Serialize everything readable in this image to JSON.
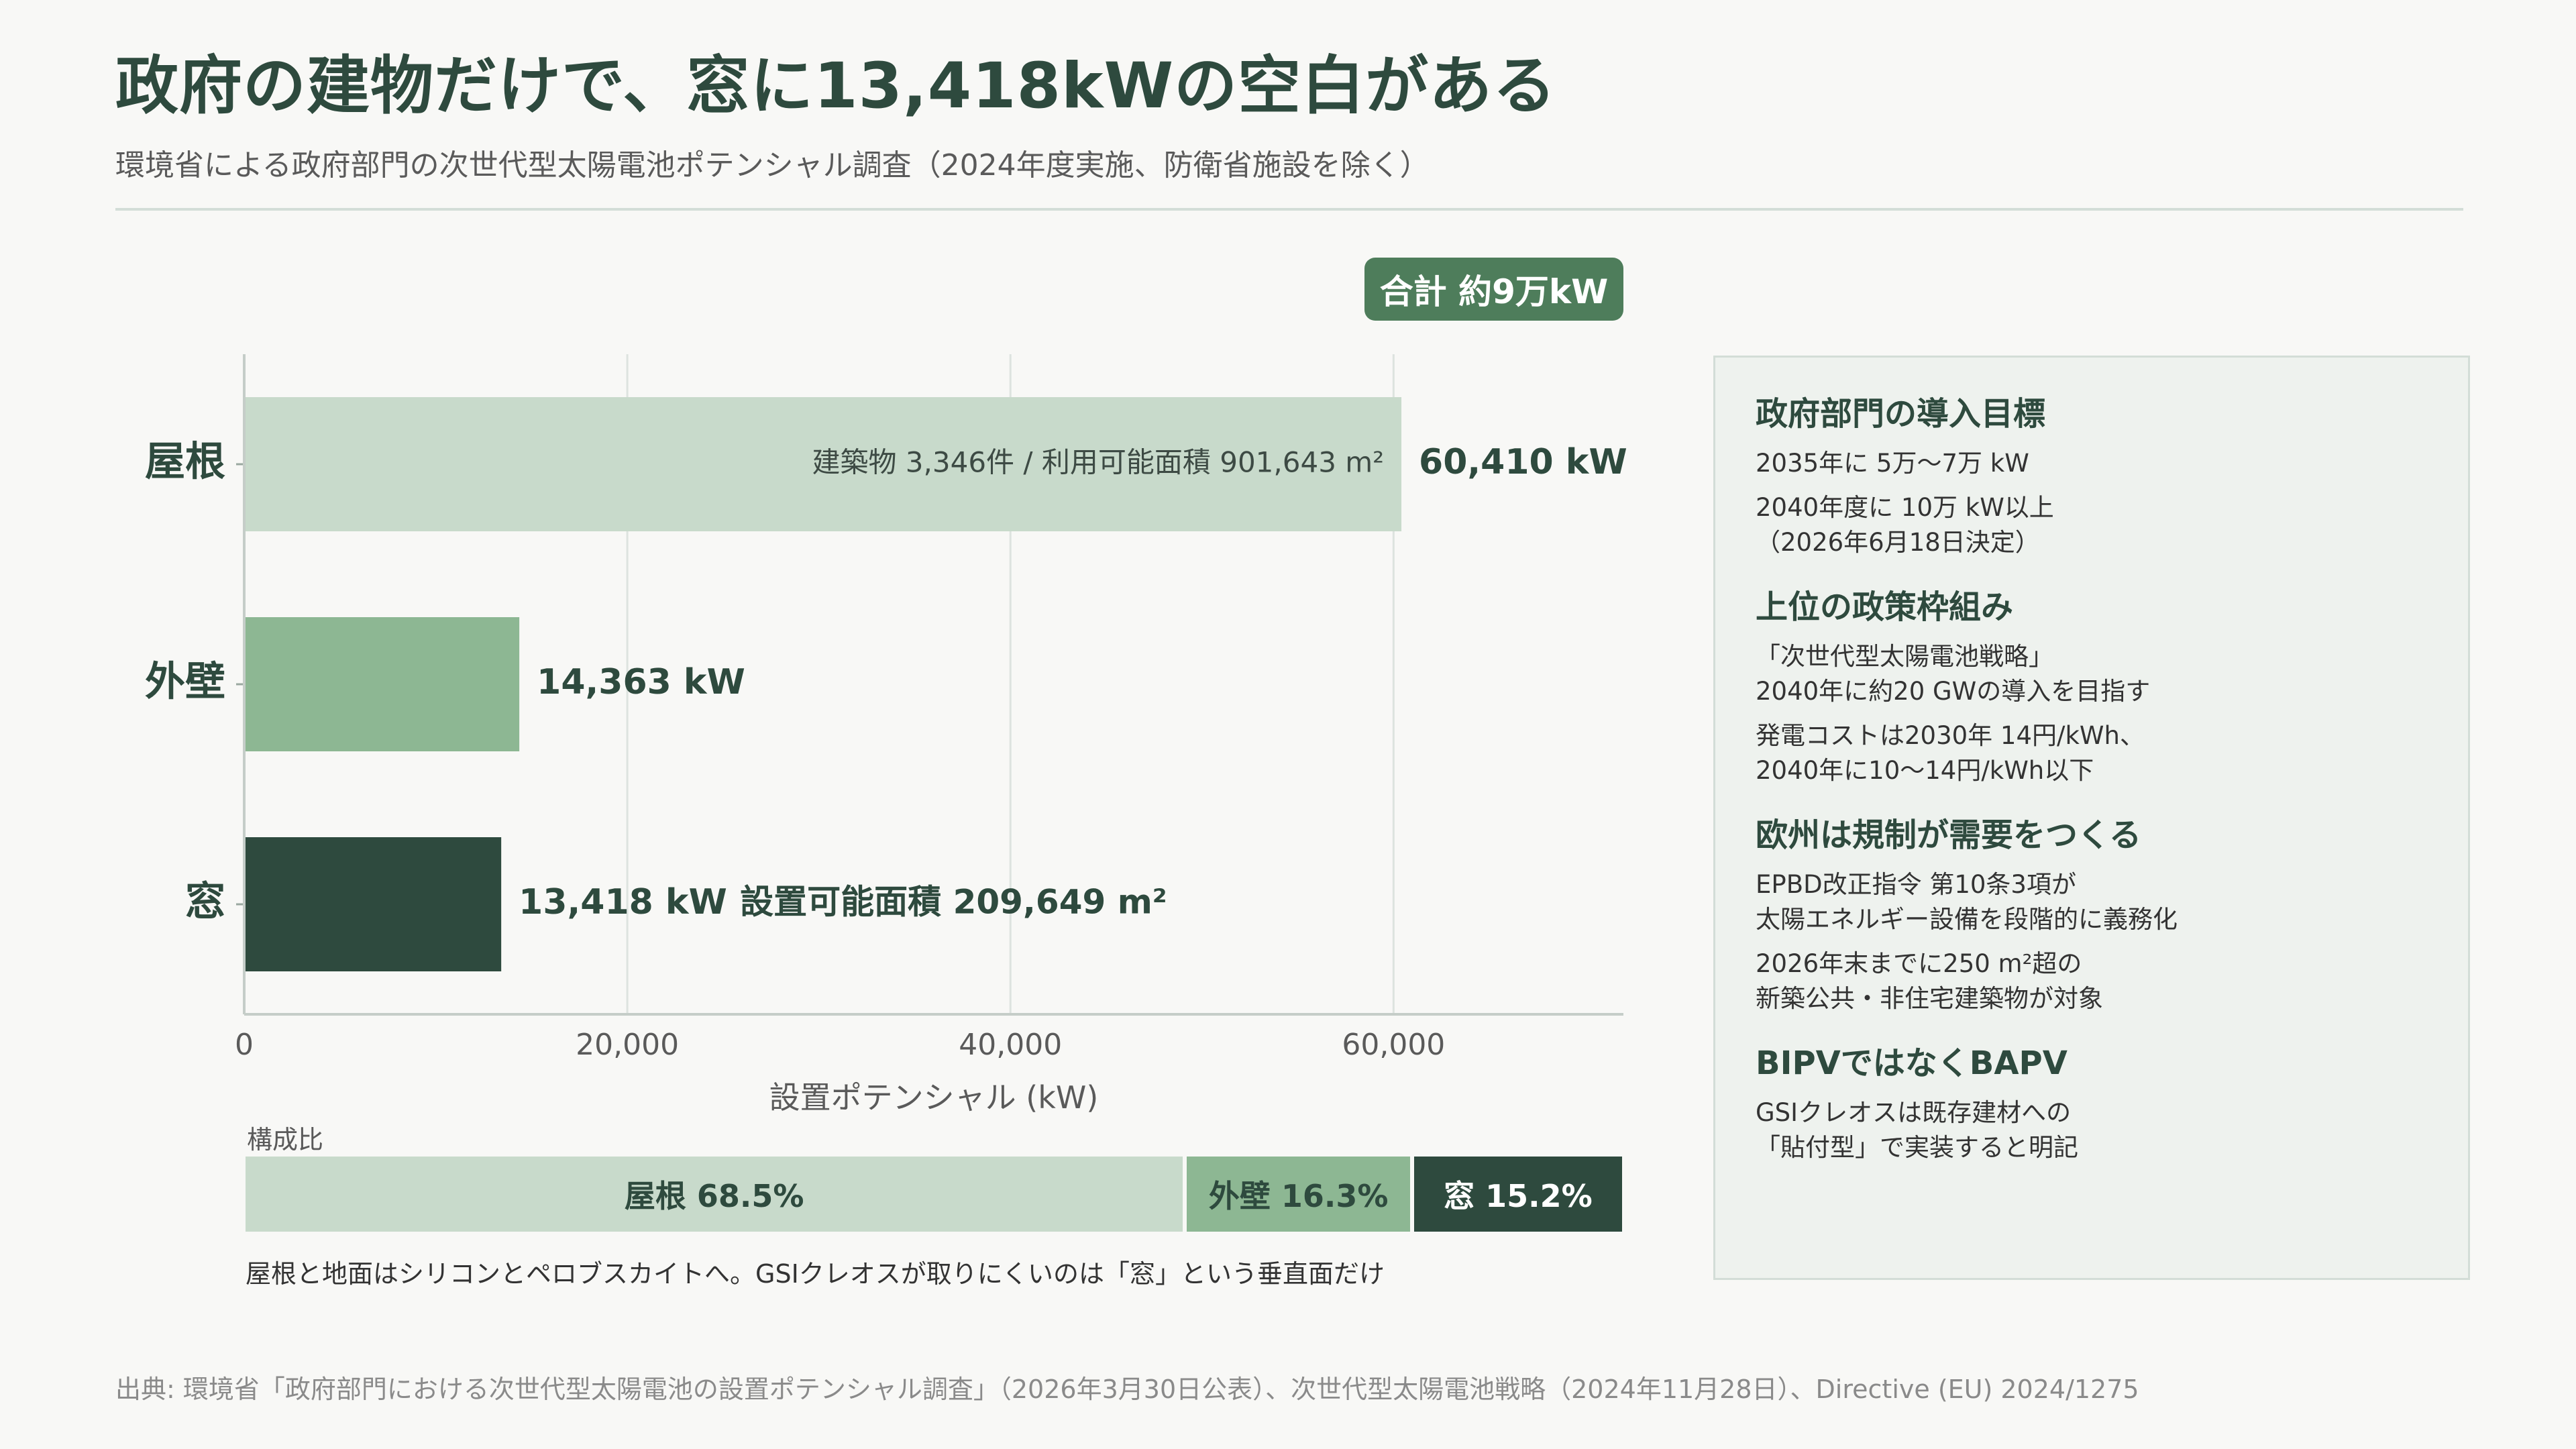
{
  "header": {
    "title": "政府の建物だけで、窓に13,418kWの空白がある",
    "subtitle": "環境省による政府部門の次世代型太陽電池ポテンシャル調査（2024年度実施、防衛省施設を除く）"
  },
  "total_badge": "合計 約9万kW",
  "chart_data": {
    "type": "bar",
    "orientation": "horizontal",
    "categories": [
      "屋根",
      "外壁",
      "窓"
    ],
    "values": [
      60410,
      14363,
      13418
    ],
    "value_labels": [
      "60,410 kW",
      "14,363 kW",
      "13,418 kW"
    ],
    "xlabel": "設置ポテンシャル (kW)",
    "xlim": [
      0,
      72000
    ],
    "xticks": [
      0,
      20000,
      40000,
      60000
    ],
    "xtick_labels": [
      "0",
      "20,000",
      "40,000",
      "60,000"
    ],
    "grid": true,
    "colors": [
      "#c8dacb",
      "#8db793",
      "#2e4a3e"
    ],
    "annotations": {
      "roof_inside": "建築物 3,346件 / 利用可能面積 901,643 m²",
      "window_after": "設置可能面積 209,649 m²"
    }
  },
  "composition": {
    "label": "構成比",
    "segments": [
      {
        "label": "屋根 68.5%",
        "share": 68.5,
        "color": "#c8dacb",
        "text_color": "#2e4a3e"
      },
      {
        "label": "外壁 16.3%",
        "share": 16.3,
        "color": "#8db793",
        "text_color": "#2e4a3e"
      },
      {
        "label": "窓 15.2%",
        "share": 15.2,
        "color": "#2e4a3e",
        "text_color": "#ffffff"
      }
    ],
    "note": "屋根と地面はシリコンとペロブスカイトへ。GSIクレオスが取りにくいのは「窓」という垂直面だけ"
  },
  "side_panel": {
    "sections": [
      {
        "heading": "政府部門の導入目標",
        "items": [
          "2035年に 5万〜7万 kW",
          "2040年度に 10万 kW以上\n（2026年6月18日決定）"
        ]
      },
      {
        "heading": "上位の政策枠組み",
        "items": [
          "「次世代型太陽電池戦略」\n2040年に約20 GWの導入を目指す",
          "発電コストは2030年 14円/kWh、\n2040年に10〜14円/kWh以下"
        ]
      },
      {
        "heading": "欧州は規制が需要をつくる",
        "items": [
          "EPBD改正指令 第10条3項が\n太陽エネルギー設備を段階的に義務化",
          "2026年末までに250 m²超の\n新築公共・非住宅建築物が対象"
        ]
      },
      {
        "heading": "BIPVではなくBAPV",
        "items": [
          "GSIクレオスは既存建材への\n「貼付型」で実装すると明記"
        ]
      }
    ]
  },
  "source": "出典: 環境省「政府部門における次世代型太陽電池の設置ポテンシャル調査」（2026年3月30日公表）、次世代型太陽電池戦略（2024年11月28日）、Directive (EU) 2024/1275"
}
